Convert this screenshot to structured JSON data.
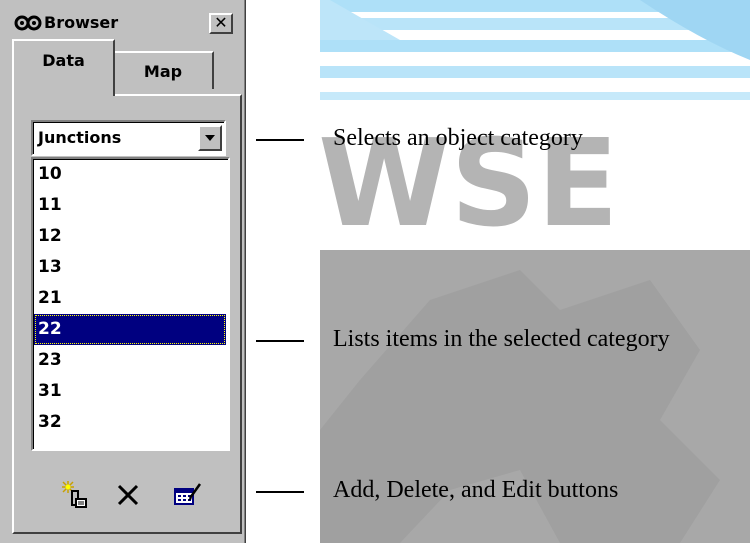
{
  "window": {
    "title": "Browser",
    "close_label": "✕"
  },
  "tabs": [
    {
      "label": "Data",
      "active": true
    },
    {
      "label": "Map",
      "active": false
    }
  ],
  "category_select": {
    "value": "Junctions"
  },
  "list": {
    "items": [
      "10",
      "11",
      "12",
      "13",
      "21",
      "22",
      "23",
      "31",
      "32"
    ],
    "selected": "22"
  },
  "toolbar": {
    "buttons": [
      {
        "name": "add-button",
        "icon": "add-icon"
      },
      {
        "name": "delete-button",
        "icon": "delete-icon"
      },
      {
        "name": "edit-button",
        "icon": "edit-icon"
      }
    ]
  },
  "callouts": {
    "category": "Selects an object category",
    "list": "Lists items in the selected category",
    "buttons": "Add, Delete, and Edit buttons"
  },
  "watermark": {
    "text": "WSE",
    "color": "#b4b4b4",
    "stripe_color": "#9ed5f2"
  }
}
